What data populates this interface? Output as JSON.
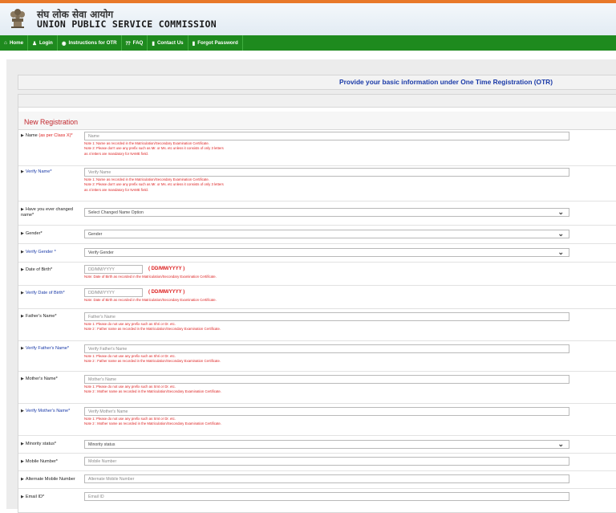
{
  "header": {
    "hindi": "संघ लोक सेवा आयोग",
    "english": "UNION PUBLIC SERVICE COMMISSION"
  },
  "nav": [
    {
      "label": "Home",
      "icon": "home-icon",
      "glyph": "⌂"
    },
    {
      "label": "Login",
      "icon": "user-icon",
      "glyph": "♟"
    },
    {
      "label": "Instructions for OTR",
      "icon": "info-icon",
      "glyph": "◉"
    },
    {
      "label": "FAQ",
      "icon": "question-icon",
      "glyph": "⁇"
    },
    {
      "label": "Contact Us",
      "icon": "phone-icon",
      "glyph": "▮"
    },
    {
      "label": "Forgot Password",
      "icon": "key-icon",
      "glyph": "▮"
    }
  ],
  "otr_title": "Provide your basic information under One Time Registration (OTR)",
  "section_title": "New Registration",
  "form": {
    "name": {
      "label": "Name",
      "label_suffix": " (as per Class X)*",
      "placeholder": "Name",
      "note1": "Note 1: Name as recorded in the Matriculation/Secondary Examination Certificate.",
      "note2": "Note 2: Please don't use any prefix such as Mr. or Ms. etc unless it consists of only 3 letters",
      "note3": "as 4 letters are mandatory for NAME field."
    },
    "verify_name": {
      "label": "Verify Name*",
      "placeholder": "Verify Name",
      "note1": "Note 1: Name as recorded in the Matriculation/Secondary Examination Certificate.",
      "note2": "Note 2: Please don't use any prefix such as Mr. or Ms. etc unless it consists of only 3 letters",
      "note3": "as 4 letters are mandatory for NAME field."
    },
    "changed_name": {
      "label1": "Have you ever changed",
      "label2": "name*",
      "value": "Select Changed Name Option"
    },
    "gender": {
      "label": "Gender*",
      "value": "Gender"
    },
    "verify_gender": {
      "label": "Verify Gender *",
      "value": "Verify Gender"
    },
    "dob": {
      "label": "Date of Birth*",
      "placeholder": "DD/MM/YYYY",
      "format": "( DD/MM/YYYY )",
      "note": "Note: Date of Birth as recorded in the Matriculation/Secondary Examination Certificate."
    },
    "verify_dob": {
      "label": "Verify Date of Birth*",
      "placeholder": "DD/MM/YYYY",
      "format": "( DD/MM/YYYY )",
      "note": "Note: Date of Birth as recorded in the Matriculation/Secondary Examination Certificate."
    },
    "father": {
      "label": "Father's Name*",
      "placeholder": "Father's Name",
      "note1": "Note 1: Please do not use any prefix such as Shri or Dr. etc.",
      "note2": "Note 2 : Father name as recorded in the Matriculation/Secondary Examination Certificate."
    },
    "verify_father": {
      "label": "Verify Father's Name*",
      "placeholder": "Verify Father's Name",
      "note1": "Note 1: Please do not use any prefix such as Shri or Dr. etc.",
      "note2": "Note 2 : Father name as recorded in the Matriculation/Secondary Examination Certificate."
    },
    "mother": {
      "label": "Mother's Name*",
      "placeholder": "Mother's Name",
      "note1": "Note 1: Please do not use any prefix such as Smt or Dr. etc.",
      "note2": "Note 2 : Mother name as recorded in the Matriculation/Secondary Examination Certificate."
    },
    "verify_mother": {
      "label": "Verify Mother's Name*",
      "placeholder": "Verify Mother's Name",
      "note1": "Note 1: Please do not use any prefix such as Smt or Dr. etc.",
      "note2": "Note 2 : Mother name as recorded in the Matriculation/Secondary Examination Certificate."
    },
    "minority": {
      "label": "Minority status*",
      "value": "Minority status"
    },
    "mobile": {
      "label": "Mobile Number*",
      "placeholder": "Mobile Number"
    },
    "alt_mobile": {
      "label": "Alternate Mobile Number",
      "placeholder": "Alternate Mobile Number"
    },
    "email": {
      "label": "Email ID*",
      "placeholder": "Email ID"
    }
  },
  "chevron_glyph": "⌄"
}
